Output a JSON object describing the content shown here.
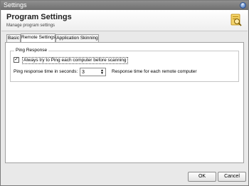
{
  "window": {
    "title": "Settings"
  },
  "header": {
    "title": "Program Settings",
    "subtitle": "Manage program settings"
  },
  "tabs": [
    {
      "label": "Basic",
      "active": false
    },
    {
      "label": "Remote Settings",
      "active": true
    },
    {
      "label": "Application Skinning",
      "active": false
    }
  ],
  "ping_group": {
    "legend": "Ping Response",
    "always_ping": {
      "label": "Always try to Ping each computer before scanning",
      "checked": true
    },
    "response_time": {
      "label": "Ping response time in seconds:",
      "value": "3",
      "suffix": "Response time for each remote computer"
    }
  },
  "footer": {
    "ok_label": "OK",
    "cancel_label": "Cancel"
  },
  "colors": {
    "titlebar": "#7f7f7f",
    "accent": "#e6a817"
  },
  "icons": {
    "header": "search-settings-icon",
    "close": "close-icon"
  }
}
